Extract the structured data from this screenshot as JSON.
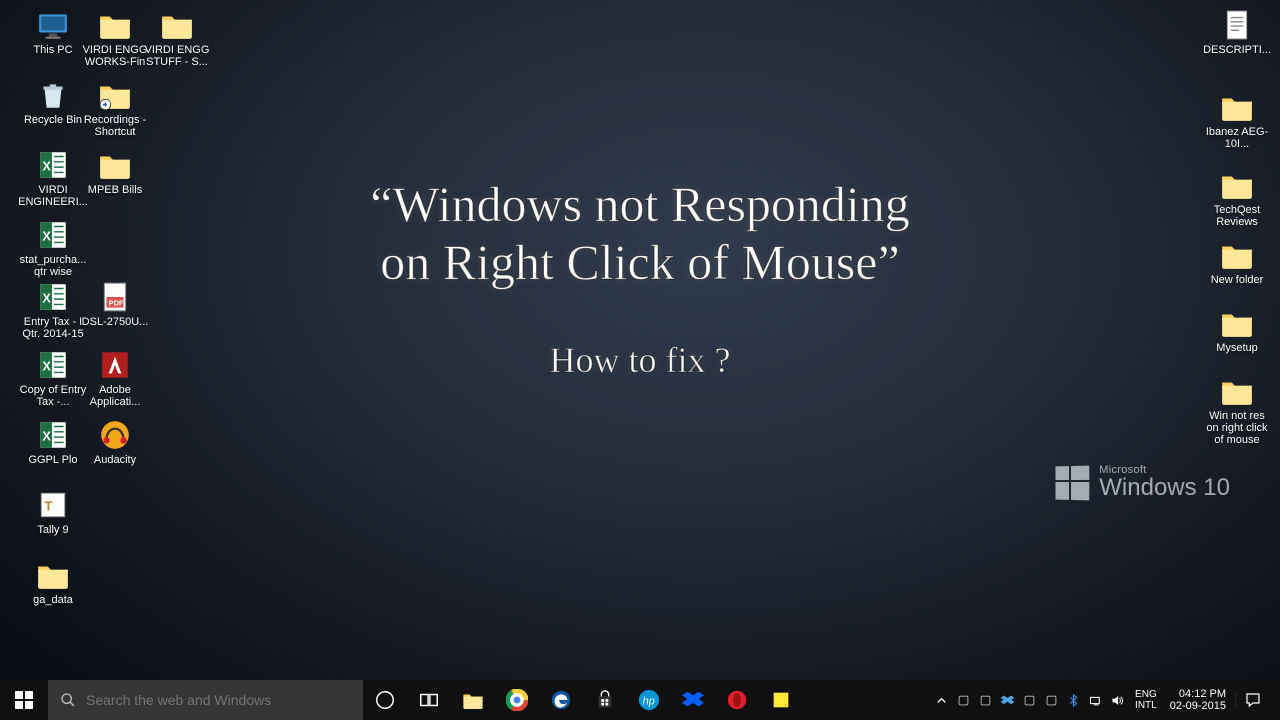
{
  "desktop_icons_left": [
    {
      "id": "this-pc",
      "label": "This PC",
      "col": 0,
      "row": 0,
      "icon": "pc"
    },
    {
      "id": "virdi-engg-works-fin",
      "label": "VIRDI ENGG WORKS-Fin",
      "col": 1,
      "row": 0,
      "icon": "folder"
    },
    {
      "id": "virdi-engg-stuff-s",
      "label": "VIRDI ENGG STUFF - S...",
      "col": 2,
      "row": 0,
      "icon": "folder"
    },
    {
      "id": "recycle-bin",
      "label": "Recycle Bin",
      "col": 0,
      "row": 1,
      "icon": "recycle"
    },
    {
      "id": "recordings-shortcut",
      "label": "Recordings - Shortcut",
      "col": 1,
      "row": 1,
      "icon": "folder-shortcut"
    },
    {
      "id": "virdi-engineeri",
      "label": "VIRDI ENGINEERI...",
      "col": 0,
      "row": 2,
      "icon": "excel"
    },
    {
      "id": "mpeb-bills",
      "label": "MPEB Bills",
      "col": 1,
      "row": 2,
      "icon": "folder"
    },
    {
      "id": "stat-purcha",
      "label": "stat_purcha... qtr wise",
      "col": 0,
      "row": 3,
      "icon": "excel"
    },
    {
      "id": "entry-tax",
      "label": "Entry Tax - I Qtr. 2014-15",
      "col": 0,
      "row": 4,
      "icon": "excel"
    },
    {
      "id": "dsl-2750u",
      "label": "DSL-2750U...",
      "col": 1,
      "row": 4,
      "icon": "pdf"
    },
    {
      "id": "copy-entry-tax",
      "label": "Copy of Entry Tax -...",
      "col": 0,
      "row": 5,
      "icon": "excel"
    },
    {
      "id": "adobe-applicati",
      "label": "Adobe Applicati...",
      "col": 1,
      "row": 5,
      "icon": "adobe"
    },
    {
      "id": "ggpl-plo",
      "label": "GGPL Plo",
      "col": 0,
      "row": 6,
      "icon": "excel"
    },
    {
      "id": "audacity",
      "label": "Audacity",
      "col": 1,
      "row": 6,
      "icon": "audacity"
    },
    {
      "id": "tally9",
      "label": "Tally 9",
      "col": 0,
      "row": 7,
      "icon": "tally"
    },
    {
      "id": "ga-data",
      "label": "ga_data",
      "col": 0,
      "row": 8,
      "icon": "folder"
    }
  ],
  "desktop_icons_right": [
    {
      "id": "descripti",
      "label": "DESCRIPTI...",
      "row": 0,
      "icon": "text"
    },
    {
      "id": "ibanez",
      "label": "Ibanez AEG-10I...",
      "row": 1,
      "icon": "folder"
    },
    {
      "id": "techqest-reviews",
      "label": "TechQest Reviews",
      "row": 2,
      "icon": "folder"
    },
    {
      "id": "new-folder",
      "label": "New folder",
      "row": 3,
      "icon": "folder"
    },
    {
      "id": "mysetup",
      "label": "Mysetup",
      "row": 4,
      "icon": "folder"
    },
    {
      "id": "win-not-res",
      "label": "Win not res on right click of mouse",
      "row": 5,
      "icon": "folder"
    }
  ],
  "overlay": {
    "line1": "“Windows not Responding",
    "line2": "on Right Click of Mouse”",
    "line3": "How to fix ?"
  },
  "watermark": {
    "brand": "Microsoft",
    "product": "Windows",
    "version": "10"
  },
  "taskbar": {
    "search_placeholder": "Search the web and Windows",
    "apps": [
      {
        "id": "taskview",
        "name": "task-view-icon"
      },
      {
        "id": "explorer",
        "name": "file-explorer-icon"
      },
      {
        "id": "chrome",
        "name": "chrome-icon"
      },
      {
        "id": "edge",
        "name": "edge-icon"
      },
      {
        "id": "store",
        "name": "store-icon"
      },
      {
        "id": "hp",
        "name": "hp-icon"
      },
      {
        "id": "dropbox",
        "name": "dropbox-icon"
      },
      {
        "id": "opera",
        "name": "opera-icon"
      },
      {
        "id": "notes",
        "name": "sticky-notes-icon"
      }
    ],
    "tray": {
      "items": [
        {
          "id": "up",
          "name": "show-hidden-icons-icon"
        },
        {
          "id": "app1",
          "name": "card-reader-icon"
        },
        {
          "id": "app2",
          "name": "monitor-icon"
        },
        {
          "id": "dropbox",
          "name": "dropbox-tray-icon"
        },
        {
          "id": "app3",
          "name": "sync-icon"
        },
        {
          "id": "app4",
          "name": "shield-icon"
        },
        {
          "id": "bt",
          "name": "bluetooth-icon"
        },
        {
          "id": "net",
          "name": "network-icon"
        },
        {
          "id": "vol",
          "name": "volume-icon"
        }
      ],
      "lang_top": "ENG",
      "lang_bottom": "INTL",
      "time": "04:12 PM",
      "date": "02-09-2015"
    }
  }
}
